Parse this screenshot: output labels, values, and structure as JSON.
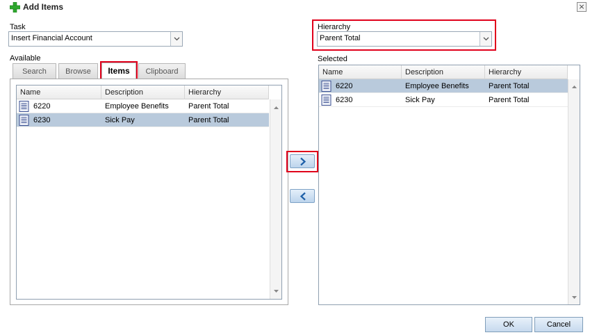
{
  "dialog": {
    "title": "Add Items",
    "close_glyph": "×"
  },
  "task": {
    "label": "Task",
    "value": "Insert Financial Account"
  },
  "hierarchy": {
    "label": "Hierarchy",
    "value": "Parent Total"
  },
  "available": {
    "label": "Available",
    "tabs": [
      {
        "label": "Search"
      },
      {
        "label": "Browse"
      },
      {
        "label": "Items",
        "active": true
      },
      {
        "label": "Clipboard"
      }
    ],
    "columns": [
      "Name",
      "Description",
      "Hierarchy"
    ],
    "rows": [
      {
        "name": "6220",
        "description": "Employee Benefits",
        "hierarchy": "Parent Total",
        "selected": false
      },
      {
        "name": "6230",
        "description": "Sick Pay",
        "hierarchy": "Parent Total",
        "selected": true
      }
    ]
  },
  "selected": {
    "label": "Selected",
    "columns": [
      "Name",
      "Description",
      "Hierarchy"
    ],
    "rows": [
      {
        "name": "6220",
        "description": "Employee Benefits",
        "hierarchy": "Parent Total",
        "selected": true
      },
      {
        "name": "6230",
        "description": "Sick Pay",
        "hierarchy": "Parent Total",
        "selected": false
      }
    ]
  },
  "buttons": {
    "ok": "OK",
    "cancel": "Cancel"
  },
  "colors": {
    "highlight_border": "#e0001b",
    "row_selected": "#b9cadc",
    "add_icon": "#2fa82f"
  }
}
